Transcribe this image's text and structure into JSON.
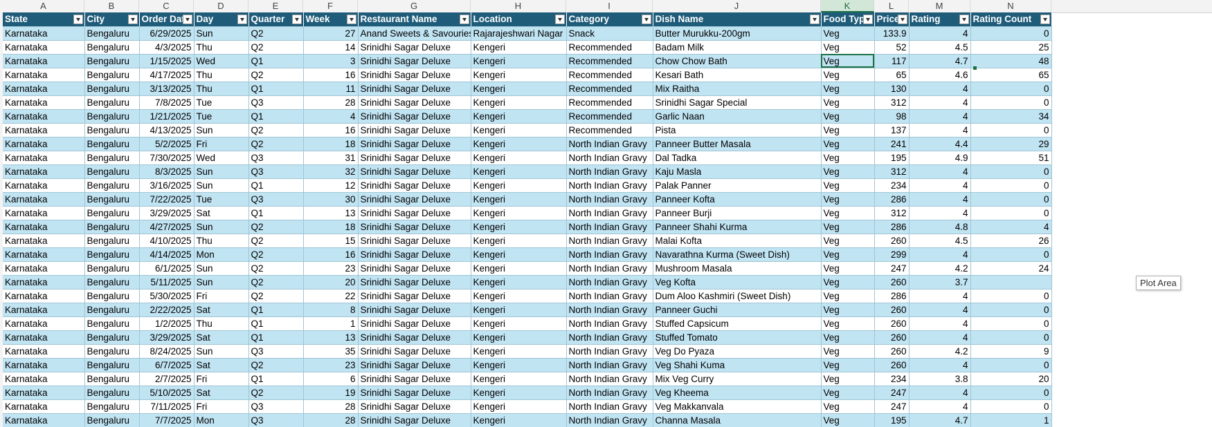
{
  "column_letters": [
    "A",
    "B",
    "C",
    "D",
    "E",
    "F",
    "G",
    "H",
    "I",
    "J",
    "K",
    "L",
    "M",
    "N"
  ],
  "selected_column": "K",
  "headers": [
    "State",
    "City",
    "Order Date",
    "Day",
    "Quarter",
    "Week",
    "Restaurant Name",
    "Location",
    "Category",
    "Dish Name",
    "Food Type",
    "Price",
    "Rating",
    "Rating Count"
  ],
  "rows": [
    [
      "Karnataka",
      "Bengaluru",
      "6/29/2025",
      "Sun",
      "Q2",
      "27",
      "Anand Sweets & Savouries",
      "Rajarajeshwari Nagar",
      "Snack",
      "Butter Murukku-200gm",
      "Veg",
      "133.9",
      "4",
      "0"
    ],
    [
      "Karnataka",
      "Bengaluru",
      "4/3/2025",
      "Thu",
      "Q2",
      "14",
      "Srinidhi Sagar Deluxe",
      "Kengeri",
      "Recommended",
      "Badam Milk",
      "Veg",
      "52",
      "4.5",
      "25"
    ],
    [
      "Karnataka",
      "Bengaluru",
      "1/15/2025",
      "Wed",
      "Q1",
      "3",
      "Srinidhi Sagar Deluxe",
      "Kengeri",
      "Recommended",
      "Chow Chow Bath",
      "Veg",
      "117",
      "4.7",
      "48"
    ],
    [
      "Karnataka",
      "Bengaluru",
      "4/17/2025",
      "Thu",
      "Q2",
      "16",
      "Srinidhi Sagar Deluxe",
      "Kengeri",
      "Recommended",
      "Kesari Bath",
      "Veg",
      "65",
      "4.6",
      "65"
    ],
    [
      "Karnataka",
      "Bengaluru",
      "3/13/2025",
      "Thu",
      "Q1",
      "11",
      "Srinidhi Sagar Deluxe",
      "Kengeri",
      "Recommended",
      "Mix Raitha",
      "Veg",
      "130",
      "4",
      "0"
    ],
    [
      "Karnataka",
      "Bengaluru",
      "7/8/2025",
      "Tue",
      "Q3",
      "28",
      "Srinidhi Sagar Deluxe",
      "Kengeri",
      "Recommended",
      "Srinidhi Sagar Special",
      "Veg",
      "312",
      "4",
      "0"
    ],
    [
      "Karnataka",
      "Bengaluru",
      "1/21/2025",
      "Tue",
      "Q1",
      "4",
      "Srinidhi Sagar Deluxe",
      "Kengeri",
      "Recommended",
      "Garlic Naan",
      "Veg",
      "98",
      "4",
      "34"
    ],
    [
      "Karnataka",
      "Bengaluru",
      "4/13/2025",
      "Sun",
      "Q2",
      "16",
      "Srinidhi Sagar Deluxe",
      "Kengeri",
      "Recommended",
      "Pista",
      "Veg",
      "137",
      "4",
      "0"
    ],
    [
      "Karnataka",
      "Bengaluru",
      "5/2/2025",
      "Fri",
      "Q2",
      "18",
      "Srinidhi Sagar Deluxe",
      "Kengeri",
      "North Indian Gravy",
      "Panneer Butter Masala",
      "Veg",
      "241",
      "4.4",
      "29"
    ],
    [
      "Karnataka",
      "Bengaluru",
      "7/30/2025",
      "Wed",
      "Q3",
      "31",
      "Srinidhi Sagar Deluxe",
      "Kengeri",
      "North Indian Gravy",
      "Dal Tadka",
      "Veg",
      "195",
      "4.9",
      "51"
    ],
    [
      "Karnataka",
      "Bengaluru",
      "8/3/2025",
      "Sun",
      "Q3",
      "32",
      "Srinidhi Sagar Deluxe",
      "Kengeri",
      "North Indian Gravy",
      "Kaju Masla",
      "Veg",
      "312",
      "4",
      "0"
    ],
    [
      "Karnataka",
      "Bengaluru",
      "3/16/2025",
      "Sun",
      "Q1",
      "12",
      "Srinidhi Sagar Deluxe",
      "Kengeri",
      "North Indian Gravy",
      "Palak Panner",
      "Veg",
      "234",
      "4",
      "0"
    ],
    [
      "Karnataka",
      "Bengaluru",
      "7/22/2025",
      "Tue",
      "Q3",
      "30",
      "Srinidhi Sagar Deluxe",
      "Kengeri",
      "North Indian Gravy",
      "Panneer Kofta",
      "Veg",
      "286",
      "4",
      "0"
    ],
    [
      "Karnataka",
      "Bengaluru",
      "3/29/2025",
      "Sat",
      "Q1",
      "13",
      "Srinidhi Sagar Deluxe",
      "Kengeri",
      "North Indian Gravy",
      "Panneer Burji",
      "Veg",
      "312",
      "4",
      "0"
    ],
    [
      "Karnataka",
      "Bengaluru",
      "4/27/2025",
      "Sun",
      "Q2",
      "18",
      "Srinidhi Sagar Deluxe",
      "Kengeri",
      "North Indian Gravy",
      "Panneer Shahi Kurma",
      "Veg",
      "286",
      "4.8",
      "4"
    ],
    [
      "Karnataka",
      "Bengaluru",
      "4/10/2025",
      "Thu",
      "Q2",
      "15",
      "Srinidhi Sagar Deluxe",
      "Kengeri",
      "North Indian Gravy",
      "Malai Kofta",
      "Veg",
      "260",
      "4.5",
      "26"
    ],
    [
      "Karnataka",
      "Bengaluru",
      "4/14/2025",
      "Mon",
      "Q2",
      "16",
      "Srinidhi Sagar Deluxe",
      "Kengeri",
      "North Indian Gravy",
      "Navarathna Kurma (Sweet Dish)",
      "Veg",
      "299",
      "4",
      "0"
    ],
    [
      "Karnataka",
      "Bengaluru",
      "6/1/2025",
      "Sun",
      "Q2",
      "23",
      "Srinidhi Sagar Deluxe",
      "Kengeri",
      "North Indian Gravy",
      "Mushroom Masala",
      "Veg",
      "247",
      "4.2",
      "24"
    ],
    [
      "Karnataka",
      "Bengaluru",
      "5/11/2025",
      "Sun",
      "Q2",
      "20",
      "Srinidhi Sagar Deluxe",
      "Kengeri",
      "North Indian Gravy",
      "Veg Kofta",
      "Veg",
      "260",
      "3.7",
      ""
    ],
    [
      "Karnataka",
      "Bengaluru",
      "5/30/2025",
      "Fri",
      "Q2",
      "22",
      "Srinidhi Sagar Deluxe",
      "Kengeri",
      "North Indian Gravy",
      "Dum Aloo Kashmiri (Sweet Dish)",
      "Veg",
      "286",
      "4",
      "0"
    ],
    [
      "Karnataka",
      "Bengaluru",
      "2/22/2025",
      "Sat",
      "Q1",
      "8",
      "Srinidhi Sagar Deluxe",
      "Kengeri",
      "North Indian Gravy",
      "Panneer Guchi",
      "Veg",
      "260",
      "4",
      "0"
    ],
    [
      "Karnataka",
      "Bengaluru",
      "1/2/2025",
      "Thu",
      "Q1",
      "1",
      "Srinidhi Sagar Deluxe",
      "Kengeri",
      "North Indian Gravy",
      "Stuffed Capsicum",
      "Veg",
      "260",
      "4",
      "0"
    ],
    [
      "Karnataka",
      "Bengaluru",
      "3/29/2025",
      "Sat",
      "Q1",
      "13",
      "Srinidhi Sagar Deluxe",
      "Kengeri",
      "North Indian Gravy",
      "Stuffed Tomato",
      "Veg",
      "260",
      "4",
      "0"
    ],
    [
      "Karnataka",
      "Bengaluru",
      "8/24/2025",
      "Sun",
      "Q3",
      "35",
      "Srinidhi Sagar Deluxe",
      "Kengeri",
      "North Indian Gravy",
      "Veg Do Pyaza",
      "Veg",
      "260",
      "4.2",
      "9"
    ],
    [
      "Karnataka",
      "Bengaluru",
      "6/7/2025",
      "Sat",
      "Q2",
      "23",
      "Srinidhi Sagar Deluxe",
      "Kengeri",
      "North Indian Gravy",
      "Veg Shahi Kuma",
      "Veg",
      "260",
      "4",
      "0"
    ],
    [
      "Karnataka",
      "Bengaluru",
      "2/7/2025",
      "Fri",
      "Q1",
      "6",
      "Srinidhi Sagar Deluxe",
      "Kengeri",
      "North Indian Gravy",
      "Mix Veg Curry",
      "Veg",
      "234",
      "3.8",
      "20"
    ],
    [
      "Karnataka",
      "Bengaluru",
      "5/10/2025",
      "Sat",
      "Q2",
      "19",
      "Srinidhi Sagar Deluxe",
      "Kengeri",
      "North Indian Gravy",
      "Veg Kheema",
      "Veg",
      "247",
      "4",
      "0"
    ],
    [
      "Karnataka",
      "Bengaluru",
      "7/11/2025",
      "Fri",
      "Q3",
      "28",
      "Srinidhi Sagar Deluxe",
      "Kengeri",
      "North Indian Gravy",
      "Veg Makkanvala",
      "Veg",
      "247",
      "4",
      "0"
    ],
    [
      "Karnataka",
      "Bengaluru",
      "7/7/2025",
      "Mon",
      "Q3",
      "28",
      "Srinidhi Sagar Deluxe",
      "Kengeri",
      "North Indian Gravy",
      "Channa Masala",
      "Veg",
      "195",
      "4.7",
      "1"
    ]
  ],
  "active_cell": {
    "row": 2,
    "col": 10
  },
  "tooltip": "Plot Area",
  "colors": {
    "header_bg": "#1f5c7a",
    "band": "#c1e4f3",
    "selection": "#1e7145"
  }
}
